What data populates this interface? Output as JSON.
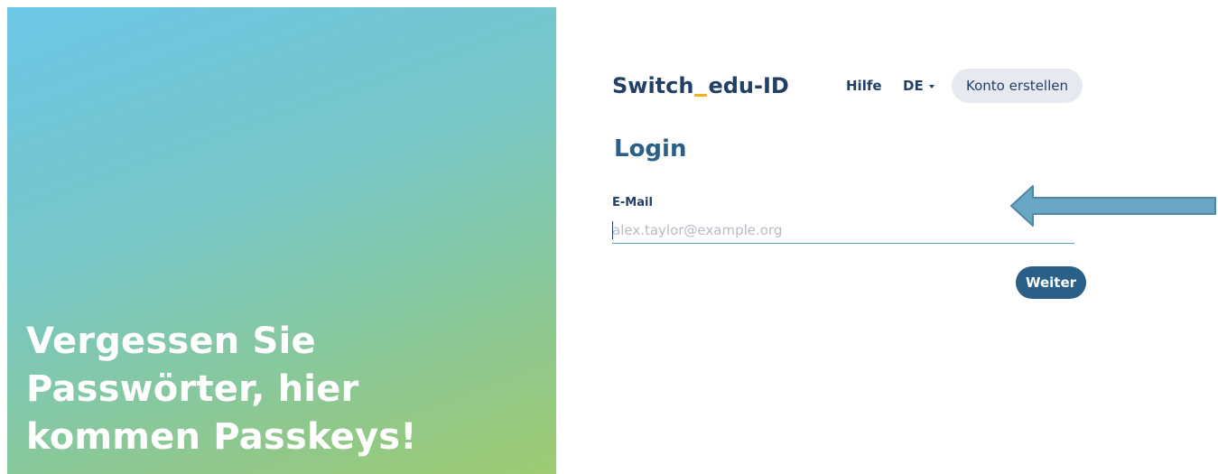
{
  "hero": {
    "lines": [
      "Vergessen Sie",
      "Passwörter, hier",
      "kommen Passkeys!"
    ]
  },
  "header": {
    "logo_part1": "Switch",
    "logo_part2": "edu-ID",
    "help_label": "Hilfe",
    "language": "DE",
    "create_account_label": "Konto erstellen"
  },
  "login": {
    "title": "Login",
    "email_label": "E-Mail",
    "email_value": "",
    "email_placeholder": "alex.taylor@example.org",
    "next_label": "Weiter"
  },
  "colors": {
    "brand_dark": "#223f65",
    "brand_blue": "#2a5f87",
    "accent_yellow": "#f5b21c",
    "button_grey": "#e6e9ef",
    "arrow_fill": "#6aa6c4"
  },
  "icons": {
    "language_dropdown": "chevron-down-icon",
    "annotation": "arrow-left-icon"
  }
}
